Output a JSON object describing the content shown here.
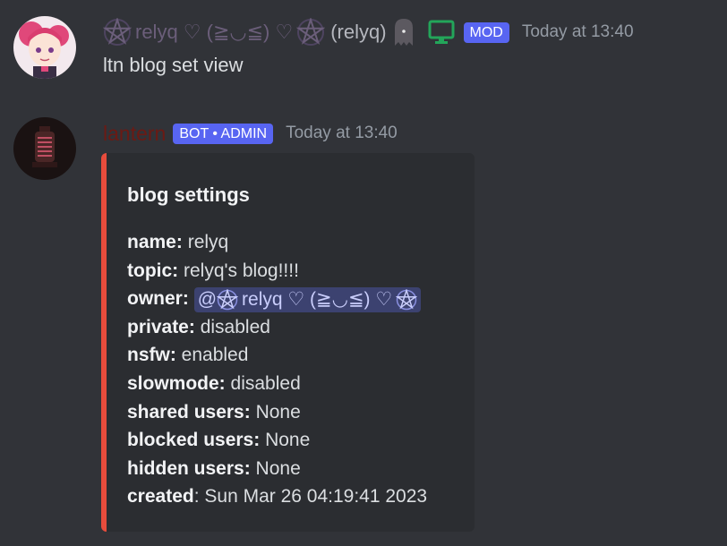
{
  "messages": [
    {
      "author": {
        "display_name": "relyq ♡ (≧◡≦) ♡",
        "username_tag": "(relyq)",
        "role_badge": "MOD"
      },
      "timestamp": "Today at 13:40",
      "content": "ltn blog set view"
    },
    {
      "author": {
        "display_name": "lantern",
        "bot_badge": "BOT • ADMIN",
        "name_color": "#6b1a14"
      },
      "timestamp": "Today at 13:40",
      "embed": {
        "accent_color": "#e74c3c",
        "title": "blog settings",
        "fields": [
          {
            "label": "name:",
            "value": "relyq"
          },
          {
            "label": "topic:",
            "value": "relyq's blog!!!!"
          },
          {
            "label": "owner:",
            "mention": "@",
            "mention_name": "relyq ♡ (≧◡≦) ♡"
          },
          {
            "label": "private:",
            "value": "disabled"
          },
          {
            "label": "nsfw:",
            "value": "enabled"
          },
          {
            "label": "slowmode:",
            "value": "disabled"
          },
          {
            "label": "shared users:",
            "value": "None"
          },
          {
            "label": "blocked users:",
            "value": "None"
          },
          {
            "label": "hidden users:",
            "value": "None"
          },
          {
            "label": "created",
            "colon_suffix": ":",
            "value": "Sun Mar 26 04:19:41 2023"
          }
        ]
      }
    }
  ],
  "icons": {
    "pentagram": "pentagram-icon",
    "ghost": "ghost-icon",
    "monitor": "monitor-icon"
  },
  "colors": {
    "background": "#313338",
    "badge": "#5865f2",
    "mention_bg": "#3c4270"
  }
}
